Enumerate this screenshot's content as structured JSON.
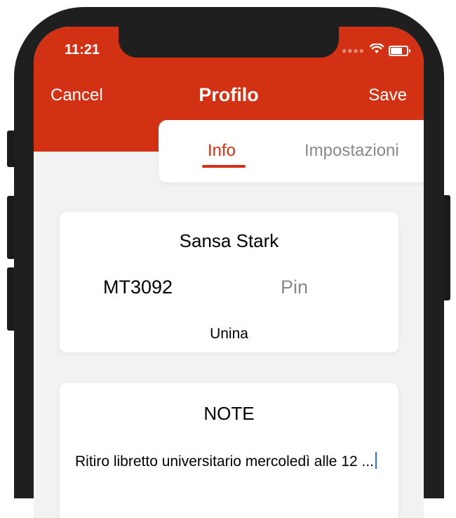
{
  "status_bar": {
    "time": "11:21",
    "signal_icon": "signal-dots-icon",
    "wifi_icon": "wifi-icon",
    "battery_icon": "battery-icon"
  },
  "nav": {
    "cancel_label": "Cancel",
    "title": "Profilo",
    "save_label": "Save"
  },
  "tabs": [
    {
      "label": "Info",
      "selected": true
    },
    {
      "label": "Impostazioni",
      "selected": false
    }
  ],
  "profile": {
    "name": "Sansa Stark",
    "code": "MT3092",
    "pin_placeholder": "Pin",
    "university": "Unina"
  },
  "notes": {
    "title": "NOTE",
    "text": "Ritiro libretto universitario mercoledì alle 12 ..."
  },
  "colors": {
    "accent": "#d23114",
    "background": "#f2f2f2",
    "muted_text": "#8a8a8a",
    "caret": "#2f6bff"
  }
}
